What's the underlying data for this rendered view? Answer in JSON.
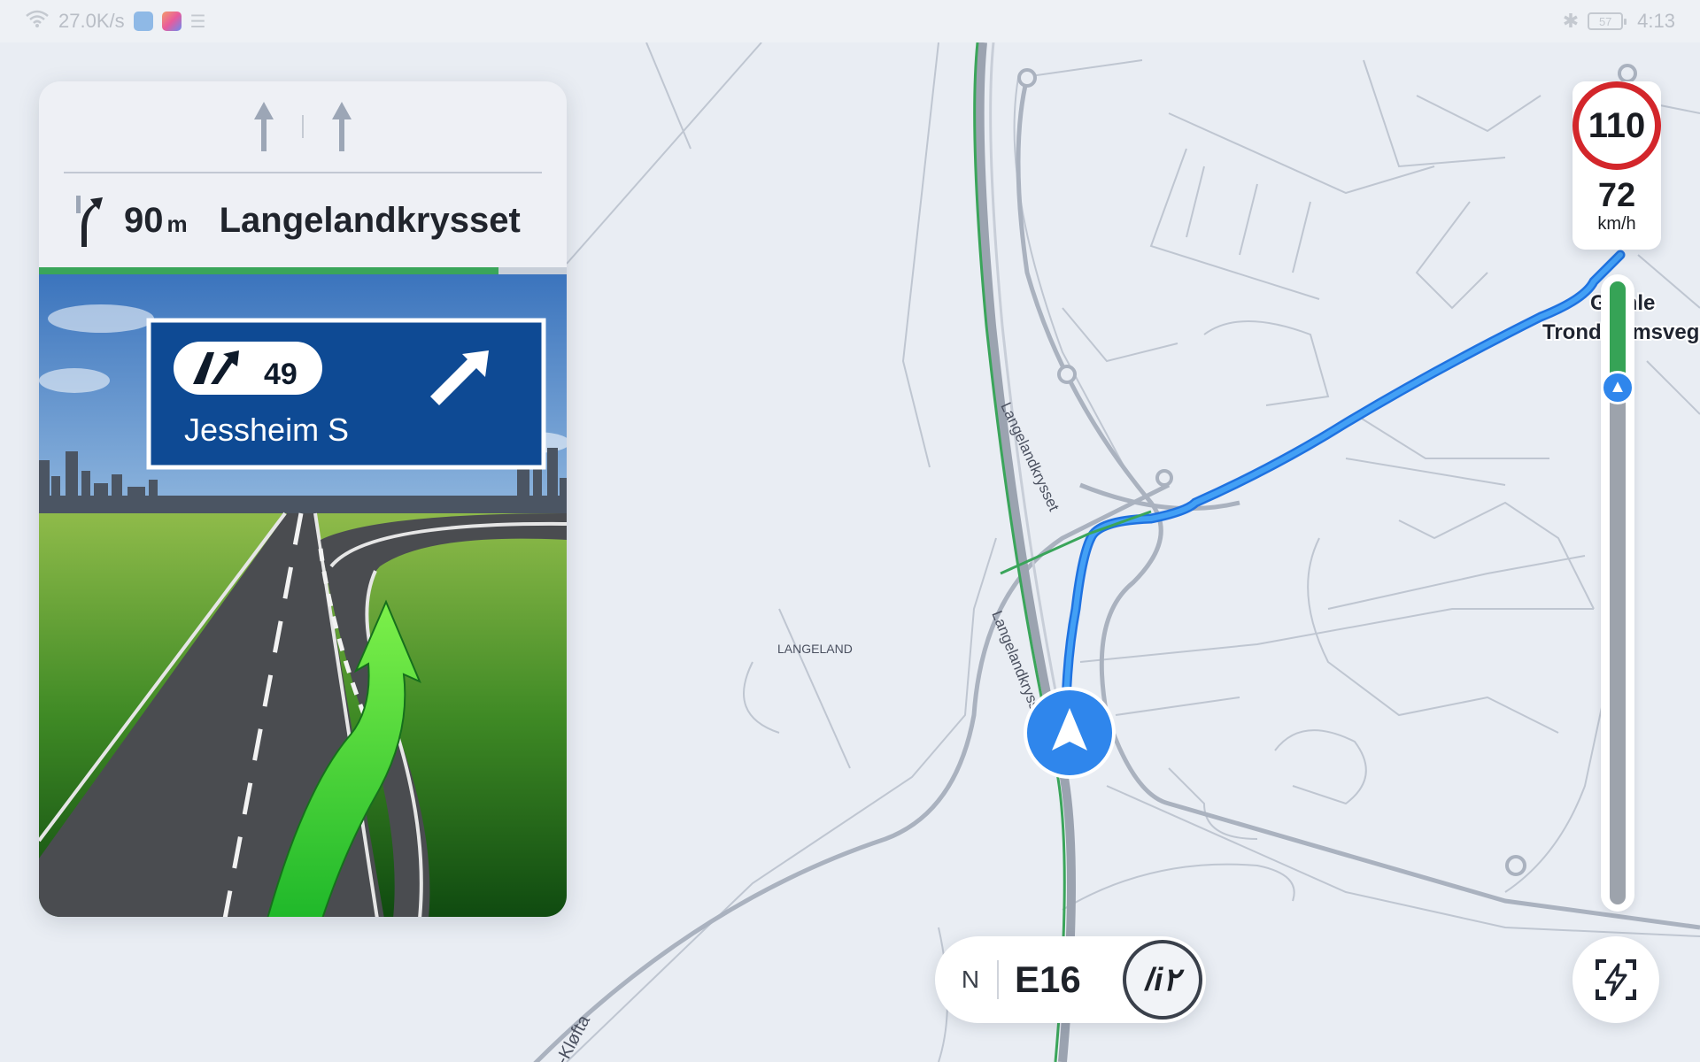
{
  "status_bar": {
    "net_speed": "27.0K/s",
    "battery": "57",
    "time": "4:13"
  },
  "guidance": {
    "distance": "90",
    "distance_unit": "m",
    "street": "Langelandkrysset",
    "progress_fraction": 0.87,
    "sign": {
      "exit_number": "49",
      "destination": "Jessheim S"
    }
  },
  "speed": {
    "limit": "110",
    "current": "72",
    "unit": "km/h"
  },
  "route_progress": {
    "completed_fraction": 0.17
  },
  "map_labels": {
    "road_a": "Langelandkrysset",
    "road_b": "Langelandkrysset",
    "place": "LANGELAND",
    "street_top_line1": "Gamle",
    "street_top_line2": "Trondheimsveg",
    "street_bottom": "egen-Kløfta"
  },
  "bottom_bar": {
    "compass": "N",
    "road": "E16",
    "voice_label": "/i۲"
  },
  "colors": {
    "route": "#2f8bf0",
    "progress": "#3aa55a",
    "speed_limit_ring": "#d3262b"
  }
}
